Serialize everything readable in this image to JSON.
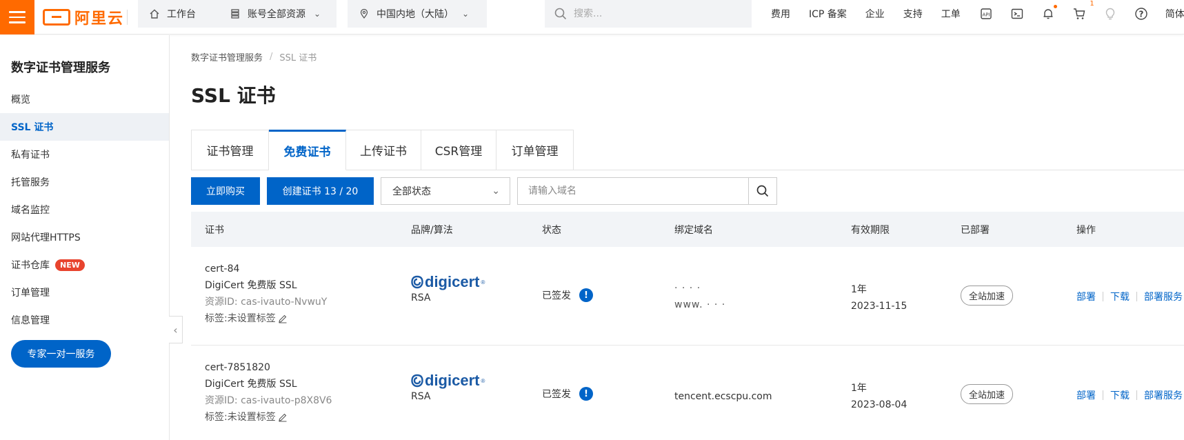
{
  "topbar": {
    "logo_text": "阿里云",
    "workbench": "工作台",
    "resources": "账号全部资源",
    "region": "中国内地（大陆）",
    "search_placeholder": "搜索...",
    "links": [
      "费用",
      "ICP 备案",
      "企业",
      "支持",
      "工单"
    ],
    "cart_badge": "1",
    "lang": "简体"
  },
  "sidebar": {
    "title": "数字证书管理服务",
    "items": [
      {
        "label": "概览"
      },
      {
        "label": "SSL 证书"
      },
      {
        "label": "私有证书"
      },
      {
        "label": "托管服务"
      },
      {
        "label": "域名监控"
      },
      {
        "label": "网站代理HTTPS"
      },
      {
        "label": "证书仓库",
        "badge": "NEW"
      },
      {
        "label": "订单管理"
      },
      {
        "label": "信息管理"
      }
    ],
    "expert_button": "专家一对一服务"
  },
  "breadcrumb": {
    "parent": "数字证书管理服务",
    "sep": "/",
    "current": "SSL 证书"
  },
  "page_title": "SSL 证书",
  "tabs": [
    "证书管理",
    "免费证书",
    "上传证书",
    "CSR管理",
    "订单管理"
  ],
  "toolbar": {
    "buy_button": "立即购买",
    "create_button": "创建证书 13 / 20",
    "status_select": "全部状态",
    "domain_placeholder": "请输入域名"
  },
  "table": {
    "headers": [
      "证书",
      "品牌/算法",
      "状态",
      "绑定域名",
      "有效期限",
      "已部署",
      "操作"
    ],
    "rows": [
      {
        "name": "cert-84",
        "product": "DigiCert 免费版 SSL",
        "resource_id": "资源ID: cas-ivauto-NvwuY",
        "tag": "标签:未设置标签",
        "brand": "digicert",
        "algo": "RSA",
        "status": "已签发",
        "domain_line1": "·  ·  ·  ·",
        "domain_line2": "www.  ·  ·  ·",
        "period": "1年",
        "expiry": "2023-11-15",
        "deployed": "全站加速",
        "ops": [
          "部署",
          "下载",
          "部署服务"
        ]
      },
      {
        "name": "cert-7851820",
        "product": "DigiCert 免费版 SSL",
        "resource_id": "资源ID: cas-ivauto-p8X8V6",
        "tag": "标签:未设置标签",
        "brand": "digicert",
        "algo": "RSA",
        "status": "已签发",
        "domain_line1": "tencent.ecscpu.com",
        "domain_line2": "",
        "period": "1年",
        "expiry": "2023-08-04",
        "deployed": "全站加速",
        "ops": [
          "部署",
          "下载",
          "部署服务"
        ]
      }
    ]
  },
  "colors": {
    "brand": "#ff6a00",
    "primary": "#0064c8",
    "badge": "#e8442e"
  }
}
